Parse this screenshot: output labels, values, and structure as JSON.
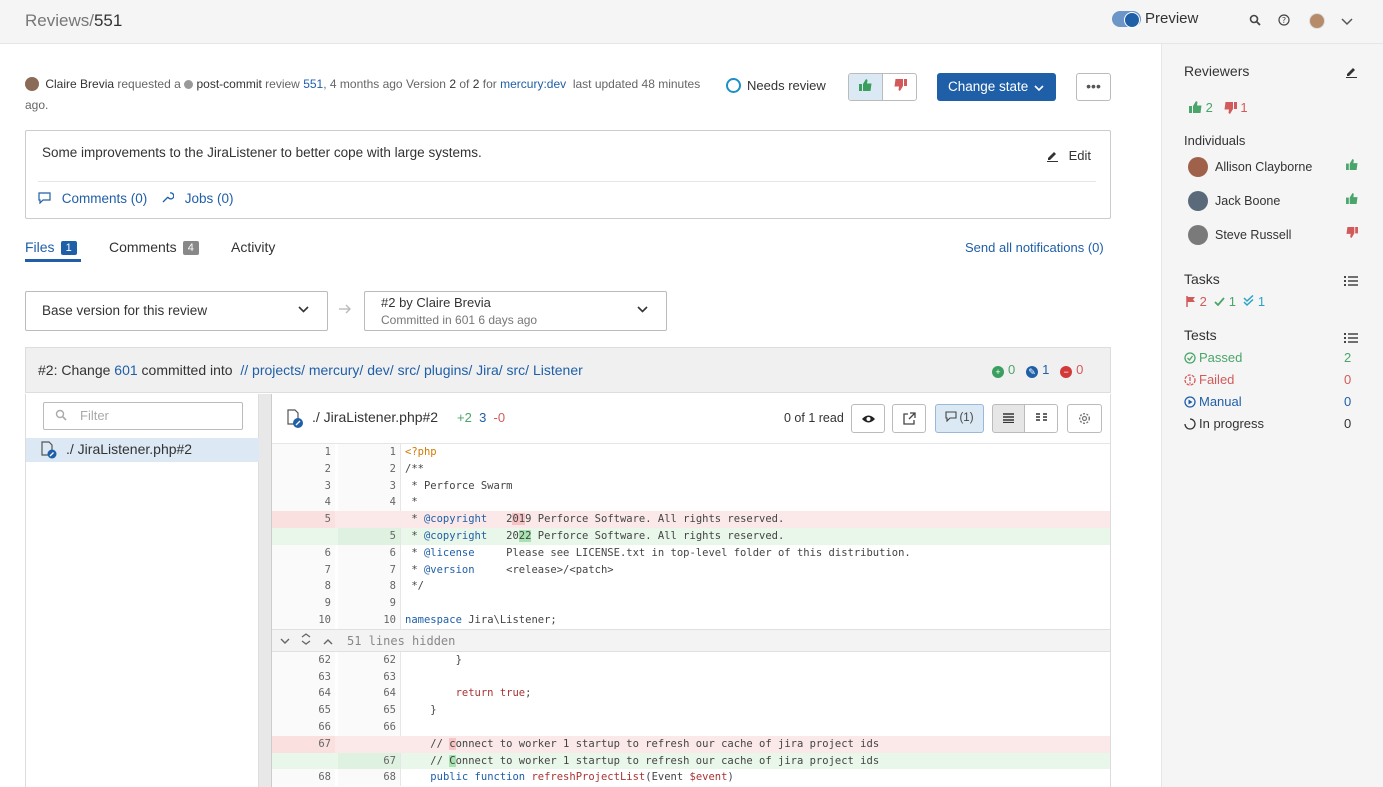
{
  "header": {
    "crumb_prefix": "Reviews/",
    "crumb_id": "551",
    "preview_label": "Preview"
  },
  "review_meta": {
    "author": "Claire Brevia",
    "requested": "requested a",
    "review_type": "post-commit",
    "review_word": "review",
    "review_id": "551",
    "age": ", 4 months ago",
    "version_word": "Version",
    "version_current": "2",
    "of_word": "of",
    "version_total": "2",
    "for_word": "for",
    "project": "mercury:dev",
    "updated": "last updated 48 minutes ago."
  },
  "state": {
    "needs_review": "Needs review",
    "change_state": "Change state",
    "more": "•••"
  },
  "description": {
    "text": "Some improvements to the JiraListener to better cope with large systems.",
    "edit": "Edit",
    "comments_link": "Comments (0)",
    "jobs_link": "Jobs (0)"
  },
  "tabs": [
    {
      "label": "Files",
      "badge": "1"
    },
    {
      "label": "Comments",
      "badge": "4"
    },
    {
      "label": "Activity",
      "badge": ""
    }
  ],
  "send_notifications": "Send all notifications (0)",
  "versions": {
    "left": "Base version for this review",
    "right_title": "#2 by Claire Brevia",
    "right_sub": "Committed in 601 6 days ago"
  },
  "change_header": {
    "prefix": "#2: Change",
    "change_id": "601",
    "committed_into": "committed into",
    "path": [
      "//",
      "projects/",
      "mercury/",
      "dev/",
      "src/",
      "plugins/",
      "Jira/",
      "src/",
      "Listener"
    ],
    "added": "0",
    "edited": "1",
    "deleted": "0"
  },
  "tree": {
    "filter_placeholder": "Filter",
    "file": "./ JiraListener.php#2"
  },
  "diff": {
    "file": "./ JiraListener.php#2",
    "plus": "+2",
    "edit": "3",
    "minus": "-0",
    "read": "0 of 1 read",
    "comments_btn": "(1)",
    "hidden_label": "51 lines hidden"
  },
  "sidebar": {
    "reviewers_title": "Reviewers",
    "up_count": "2",
    "down_count": "1",
    "individuals_title": "Individuals",
    "people": [
      {
        "name": "Allison Clayborne",
        "vote": "up"
      },
      {
        "name": "Jack Boone",
        "vote": "up"
      },
      {
        "name": "Steve Russell",
        "vote": "down"
      }
    ],
    "tasks_title": "Tasks",
    "tasks_open": "2",
    "tasks_done": "1",
    "tasks_verified": "1",
    "tests_title": "Tests",
    "tests": [
      {
        "label": "Passed",
        "value": "2",
        "color": "#4aa56a"
      },
      {
        "label": "Failed",
        "value": "0",
        "color": "#d25a5a"
      },
      {
        "label": "Manual",
        "value": "0",
        "color": "#1f5fa8"
      },
      {
        "label": "In progress",
        "value": "0",
        "color": "#333333"
      }
    ]
  },
  "colors": {
    "accent": "#1f5fa8",
    "positive": "#4aa56a",
    "negative": "#d25a5a"
  }
}
